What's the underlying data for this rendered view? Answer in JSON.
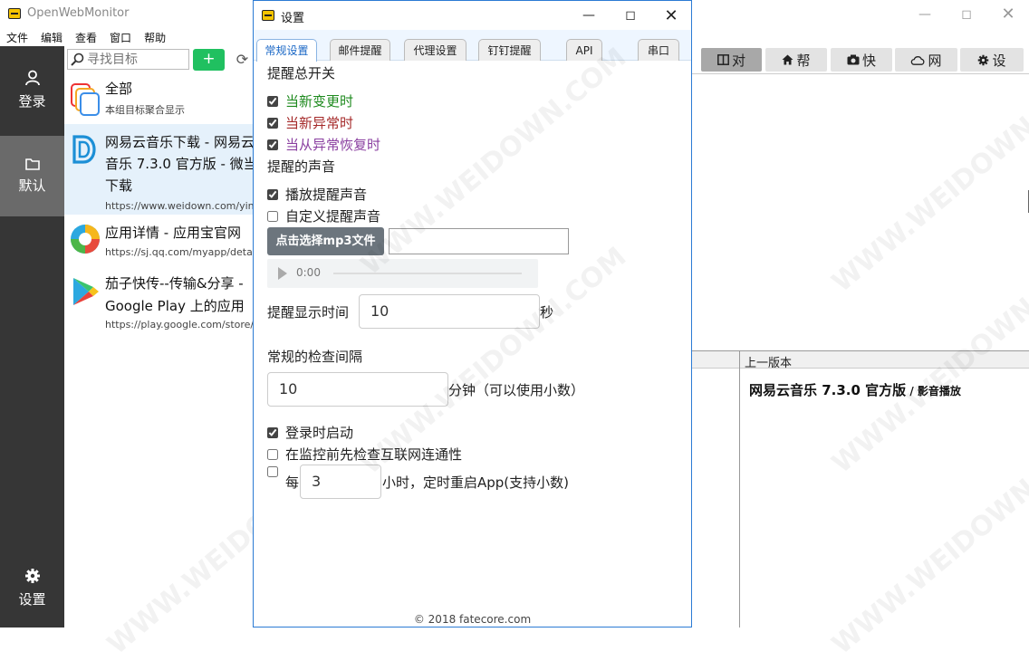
{
  "main_window": {
    "title": "OpenWebMonitor",
    "menu": [
      "文件",
      "编辑",
      "查看",
      "窗口",
      "帮助"
    ],
    "sidebar": {
      "login_label": "登录",
      "default_label": "默认",
      "settings_label": "设置"
    },
    "search": {
      "placeholder": "寻找目标",
      "add_label": "+"
    },
    "targets": [
      {
        "title": "全部",
        "subtitle": "本组目标聚合显示"
      },
      {
        "title_line1": "网易云音乐下载 - 网易云",
        "title_line2": "音乐 7.3.0 官方版 - 微当",
        "title_line3": "下载",
        "url": "https://www.weidown.com/yingyin"
      },
      {
        "title": "应用详情 - 应用宝官网",
        "url": "https://sj.qq.com/myapp/detail.htm"
      },
      {
        "title_line1": "茄子快传--传输&分享 -",
        "title_line2": "Google Play 上的应用",
        "url": "https://play.google.com/store/apps"
      }
    ],
    "toolbar": [
      {
        "label": "对",
        "icon": "compare-icon"
      },
      {
        "label": "帮",
        "icon": "home-icon"
      },
      {
        "label": "快",
        "icon": "camera-icon"
      },
      {
        "label": "网",
        "icon": "cloud-icon"
      },
      {
        "label": "设",
        "icon": "gear-icon"
      }
    ],
    "previous_version": {
      "header": "上一版本",
      "content_title": "网易云音乐 7.3.0 官方版",
      "content_suffix": " / 影音播放"
    }
  },
  "settings": {
    "title": "设置",
    "tabs": [
      "常规设置",
      "邮件提醒",
      "代理设置",
      "钉钉提醒",
      "API",
      "串口"
    ],
    "section_alert_switch": "提醒总开关",
    "alert_options": [
      {
        "label": "当新变更时",
        "checked": true,
        "color": "#1e8a1e"
      },
      {
        "label": "当新异常时",
        "checked": true,
        "color": "#a52a2a"
      },
      {
        "label": "当从异常恢复时",
        "checked": true,
        "color": "#8a3fa0"
      }
    ],
    "section_sound": "提醒的声音",
    "sound_options": [
      {
        "label": "播放提醒声音",
        "checked": true
      },
      {
        "label": "自定义提醒声音",
        "checked": false
      }
    ],
    "mp3_button": "点击选择mp3文件",
    "audio_time": "0:00",
    "display_time_label": "提醒显示时间",
    "display_time_value": "10",
    "display_time_unit": "秒",
    "interval_label": "常规的检查间隔",
    "interval_value": "10",
    "interval_unit": "分钟（可以使用小数）",
    "misc_options": [
      {
        "label": "登录时启动",
        "checked": true
      },
      {
        "label": "在监控前先检查互联网连通性",
        "checked": false
      }
    ],
    "restart_checked": false,
    "restart_prefix": "每",
    "restart_value": "3",
    "restart_suffix": "小时，定时重启App(支持小数)",
    "footer": "© 2018 fatecore.com"
  },
  "colors": {
    "sidebar_bg": "#363636",
    "sidebar_active": "#6a6a6a",
    "add_button": "#20c060",
    "dialog_border": "#2b7bd4",
    "tab_active_text": "#1866c5",
    "mp3_button": "#6c757d"
  },
  "watermark": "WWW.WEIDOWN.COM"
}
